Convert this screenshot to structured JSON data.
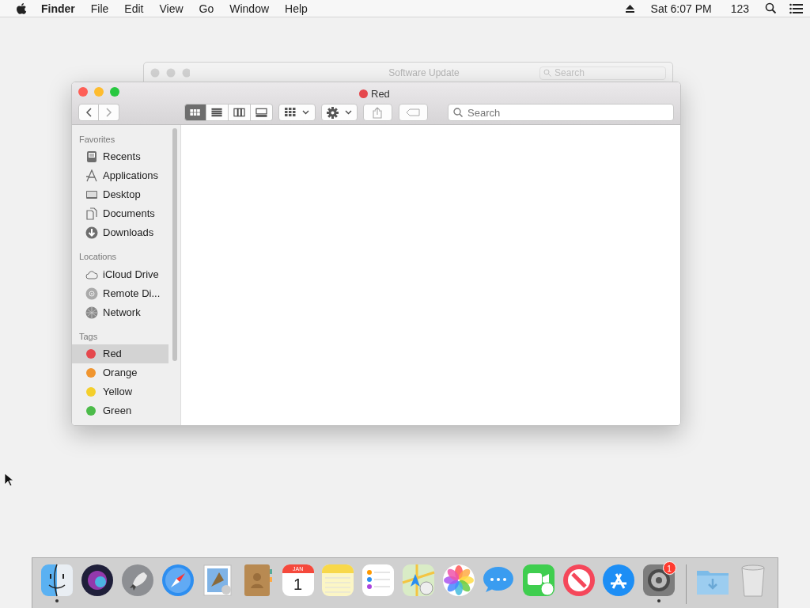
{
  "menu_bar": {
    "items": [
      {
        "label": "Finder",
        "kind": "app"
      },
      {
        "label": "File",
        "kind": "menu"
      },
      {
        "label": "Edit",
        "kind": "menu"
      },
      {
        "label": "View",
        "kind": "menu"
      },
      {
        "label": "Go",
        "kind": "menu"
      },
      {
        "label": "Window",
        "kind": "menu"
      },
      {
        "label": "Help",
        "kind": "menu"
      }
    ],
    "clock": "Sat 6:07 PM",
    "input_source": "123"
  },
  "background_window": {
    "title": "Software Update",
    "search": {
      "placeholder": "Search"
    }
  },
  "window": {
    "title": "Red",
    "tag": {
      "color": "#e5484d"
    },
    "view_buttons": [
      {
        "kind": "icons",
        "selected": true
      },
      {
        "kind": "list",
        "selected": false
      },
      {
        "kind": "columns",
        "selected": false
      },
      {
        "kind": "gallery",
        "selected": false
      }
    ],
    "search": {
      "placeholder": "Search"
    },
    "sidebar": {
      "sections": [
        {
          "heading": "Favorites",
          "items": [
            {
              "label": "Recents",
              "kind": "recents",
              "selected": false
            },
            {
              "label": "Applications",
              "kind": "applications",
              "selected": false
            },
            {
              "label": "Desktop",
              "kind": "desktop",
              "selected": false
            },
            {
              "label": "Documents",
              "kind": "documents",
              "selected": false
            },
            {
              "label": "Downloads",
              "kind": "downloads",
              "selected": false
            }
          ]
        },
        {
          "heading": "Locations",
          "items": [
            {
              "label": "iCloud Drive",
              "kind": "cloud",
              "selected": false
            },
            {
              "label": "Remote Di...",
              "kind": "disc",
              "selected": false
            },
            {
              "label": "Network",
              "kind": "network",
              "selected": false
            }
          ]
        },
        {
          "heading": "Tags",
          "items": [
            {
              "label": "Red",
              "kind": "tag",
              "color": "#e5484d",
              "selected": true
            },
            {
              "label": "Orange",
              "kind": "tag",
              "color": "#f0952f",
              "selected": false
            },
            {
              "label": "Yellow",
              "kind": "tag",
              "color": "#f4cf2c",
              "selected": false
            },
            {
              "label": "Green",
              "kind": "tag",
              "color": "#4cbb4a",
              "selected": false
            }
          ]
        }
      ]
    }
  },
  "dock": {
    "items": [
      {
        "kind": "finder",
        "running": true
      },
      {
        "kind": "siri",
        "running": false
      },
      {
        "kind": "rocket",
        "running": false
      },
      {
        "kind": "compass",
        "running": false
      },
      {
        "kind": "stamp",
        "running": false
      },
      {
        "kind": "contacts",
        "running": false
      },
      {
        "kind": "calendar",
        "running": false,
        "month": "JAN",
        "day": "1"
      },
      {
        "kind": "notes",
        "running": false
      },
      {
        "kind": "reminders",
        "running": false
      },
      {
        "kind": "maps",
        "running": false
      },
      {
        "kind": "photos",
        "running": false
      },
      {
        "kind": "messages",
        "running": false
      },
      {
        "kind": "facetime",
        "running": false
      },
      {
        "kind": "news",
        "running": false
      },
      {
        "kind": "appstore",
        "running": false
      },
      {
        "kind": "settings",
        "running": true,
        "badge": "1"
      },
      {
        "kind": "downloads_folder",
        "running": false
      },
      {
        "kind": "trash",
        "running": false
      }
    ]
  }
}
